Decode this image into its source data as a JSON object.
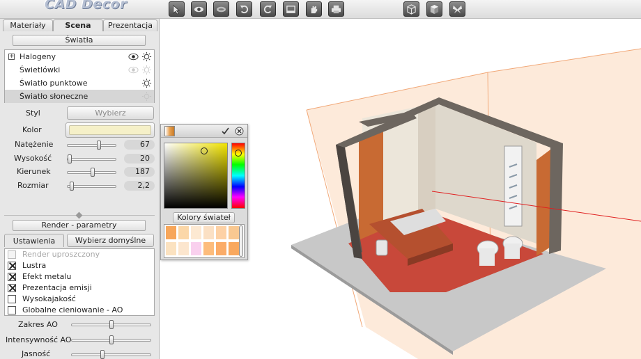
{
  "app": {
    "logo_text": "CAD Decor"
  },
  "toolbar": {
    "buttons": [
      "select-icon",
      "eye-icon",
      "eye-closed-icon",
      "undo-icon",
      "redo-icon",
      "window-icon",
      "hand-icon",
      "print-icon",
      "cube-wireframe-icon",
      "cube-solid-icon",
      "butterfly-icon"
    ]
  },
  "tabs": [
    {
      "label": "Materiały"
    },
    {
      "label": "Scena"
    },
    {
      "label": "Prezentacja"
    }
  ],
  "lights": {
    "title": "Światła",
    "items": [
      {
        "label": "Halogeny"
      },
      {
        "label": "Świetlówki"
      },
      {
        "label": "Światło punktowe"
      },
      {
        "label": "Światło słoneczne"
      }
    ],
    "selected_index": 3
  },
  "properties": {
    "style_label": "Styl",
    "style_button": "Wybierz",
    "color_label": "Kolor",
    "color_value": "#f5f0c8",
    "sliders": [
      {
        "label": "Natężenie",
        "value": "67",
        "fraction": 0.67
      },
      {
        "label": "Wysokość",
        "value": "20",
        "fraction": 0.0
      },
      {
        "label": "Kierunek",
        "value": "187",
        "fraction": 0.52
      },
      {
        "label": "Rozmiar",
        "value": "2,2",
        "fraction": 0.05
      }
    ]
  },
  "render": {
    "title": "Render - parametry",
    "settings_label": "Ustawienia",
    "default_button": "Wybierz domyślne",
    "options": [
      {
        "label": "Render uproszczony",
        "checked": false,
        "disabled": true
      },
      {
        "label": "Lustra",
        "checked": true,
        "disabled": false
      },
      {
        "label": "Efekt metalu",
        "checked": true,
        "disabled": false
      },
      {
        "label": "Prezentacja emisji",
        "checked": true,
        "disabled": false
      },
      {
        "label": "Wysokajakość",
        "checked": false,
        "disabled": false
      },
      {
        "label": "Globalne cieniowanie - AO",
        "checked": false,
        "disabled": false
      }
    ],
    "sliders": [
      {
        "label": "Zakres AO",
        "fraction": 0.5
      },
      {
        "label": "Intensywność AO",
        "fraction": 0.5
      },
      {
        "label": "Jasność",
        "fraction": 0.38
      }
    ]
  },
  "color_picker": {
    "palette_label": "Kolory świateł",
    "palette": [
      "#f7a65a",
      "#fbd7a8",
      "#fde9d2",
      "#fbe0c4",
      "#fdd1a5",
      "#f9c891",
      "#fbe2c0",
      "#fce6ce",
      "#f9d0ee",
      "#fdbc7c",
      "#fbac68",
      "#f9a85e"
    ]
  },
  "colors": {
    "accent_orange": "#f7a65a",
    "floor_red": "#c8483a",
    "wall_gray": "#6d665f"
  }
}
